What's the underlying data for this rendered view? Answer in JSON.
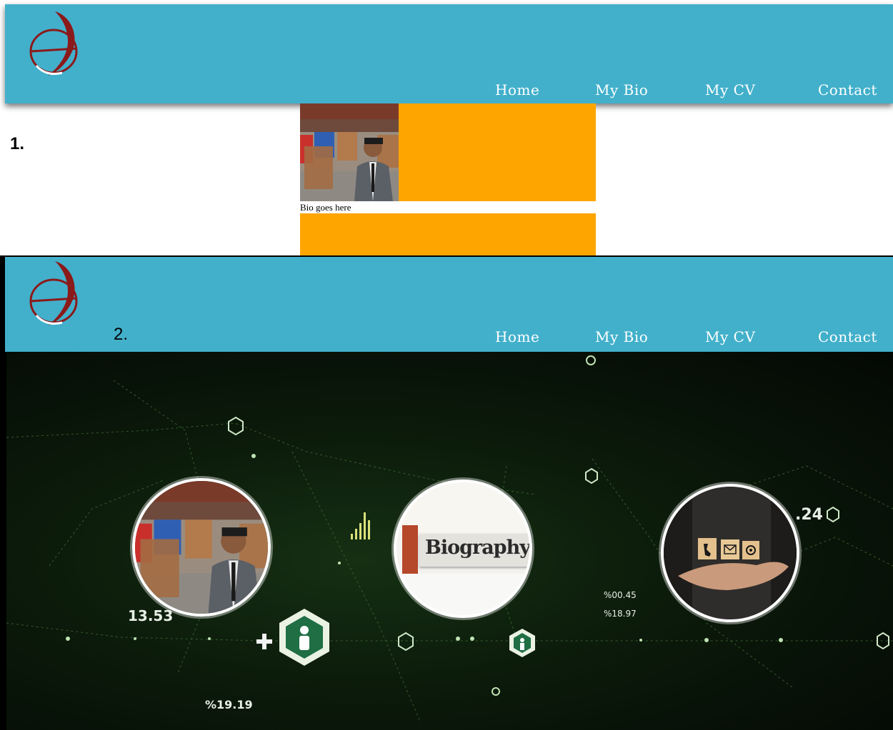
{
  "nav": {
    "home": "Home",
    "bio": "My Bio",
    "cv": "My CV",
    "contact": "Contact"
  },
  "panel1": {
    "step": "1.",
    "bio_text": "Bio goes here"
  },
  "panel2": {
    "step": "2.",
    "biography_sign": "Biography",
    "hud": {
      "v1": "13.53",
      "v2": "%19.19",
      "v3": "%00.45",
      "v4": "%18.97",
      "v5": ".24"
    }
  },
  "colors": {
    "header": "#42b0cb",
    "orange": "#ffa500",
    "logo": "#8b1a1a"
  },
  "icons": [
    "logo-icon",
    "person-hex-icon",
    "plus-icon",
    "bar-chart-icon",
    "phone-icon",
    "mail-icon",
    "at-icon"
  ]
}
